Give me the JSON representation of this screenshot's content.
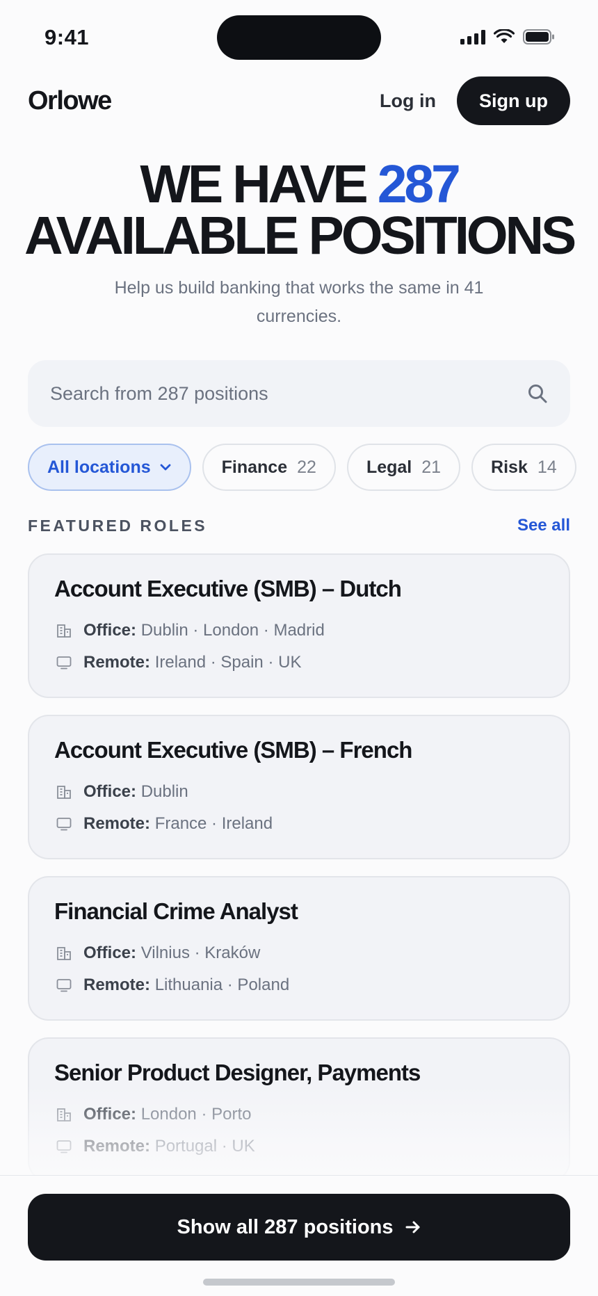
{
  "status_bar": {
    "time": "9:41"
  },
  "brand": {
    "name": "Orlowe",
    "accent_color": "#2457d6"
  },
  "nav": {
    "login_label": "Log in",
    "signup_label": "Sign up"
  },
  "hero": {
    "line1_prefix": "WE HAVE ",
    "line1_accent": "287",
    "line2": "AVAILABLE POSITIONS",
    "subtitle": "Help us build banking that works the same in 41 currencies."
  },
  "search": {
    "placeholder": "Search from 287 positions",
    "icon": "search-icon"
  },
  "filters": {
    "location": {
      "label": "All locations",
      "icon": "chevron-down-icon"
    },
    "chips": [
      {
        "label": "Finance",
        "count": "22"
      },
      {
        "label": "Legal",
        "count": "21"
      },
      {
        "label": "Risk",
        "count": "14"
      }
    ]
  },
  "featured": {
    "title": "FEATURED ROLES",
    "see_all": "See all",
    "office_label": "Office:",
    "remote_label": "Remote:",
    "roles": [
      {
        "title": "Account Executive (SMB) – Dutch",
        "office": "Dublin · London · Madrid",
        "remote": "Ireland · Spain · UK"
      },
      {
        "title": "Account Executive (SMB) – French",
        "office": "Dublin",
        "remote": "France · Ireland"
      },
      {
        "title": "Financial Crime Analyst",
        "office": "Vilnius · Kraków",
        "remote": "Lithuania · Poland"
      },
      {
        "title": "Senior Product Designer, Payments",
        "office": "London · Porto",
        "remote": "Portugal · UK"
      }
    ]
  },
  "cta": {
    "label": "Show all 287 positions",
    "icon": "arrow-right-icon"
  }
}
